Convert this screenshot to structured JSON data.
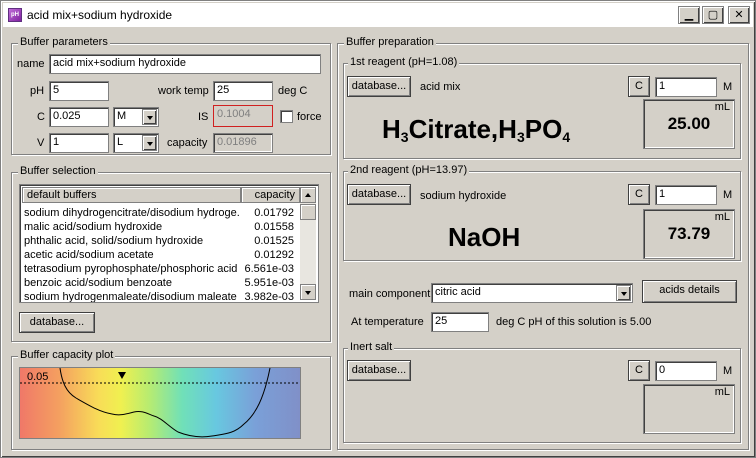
{
  "window": {
    "title": "acid mix+sodium hydroxide",
    "icon_text": "pH"
  },
  "buffer_parameters": {
    "legend": "Buffer parameters",
    "name_label": "name",
    "name_value": "acid mix+sodium hydroxide",
    "ph_label": "pH",
    "ph_value": "5",
    "work_temp_label": "work temp",
    "work_temp_value": "25",
    "work_temp_unit": "deg C",
    "c_label": "C",
    "c_value": "0.025",
    "c_unit": "M",
    "is_label": "IS",
    "is_value": "0.1004",
    "force_label": "force",
    "v_label": "V",
    "v_value": "1",
    "v_unit": "L",
    "capacity_label": "capacity",
    "capacity_value": "0.01896"
  },
  "buffer_selection": {
    "legend": "Buffer selection",
    "columns": [
      "default buffers",
      "capacity"
    ],
    "rows": [
      {
        "name": "sodium dihydrogencitrate/disodium hydroge...",
        "capacity": "0.01792"
      },
      {
        "name": "malic acid/sodium hydroxide",
        "capacity": "0.01558"
      },
      {
        "name": "phthalic acid, solid/sodium hydroxide",
        "capacity": "0.01525"
      },
      {
        "name": "acetic acid/sodium acetate",
        "capacity": "0.01292"
      },
      {
        "name": "tetrasodium pyrophosphate/phosphoric acid",
        "capacity": "6.561e-03"
      },
      {
        "name": "benzoic acid/sodium benzoate",
        "capacity": "5.951e-03"
      },
      {
        "name": "sodium hydrogenmaleate/disodium maleate",
        "capacity": "3.982e-03"
      }
    ],
    "database_button": "database..."
  },
  "capacity_plot": {
    "legend": "Buffer capacity plot",
    "level_label": "0.05"
  },
  "buffer_preparation": {
    "legend": "Buffer preparation",
    "reagent1": {
      "legend": "1st reagent (pH=1.08)",
      "database_button": "database...",
      "name": "acid mix",
      "c_button": "C",
      "c_value": "1",
      "c_unit": "M",
      "formula_parts": [
        "H",
        "3",
        "Citrate,H",
        "3",
        "PO",
        "4"
      ],
      "volume_unit": "mL",
      "volume": "25.00"
    },
    "reagent2": {
      "legend": "2nd reagent (pH=13.97)",
      "database_button": "database...",
      "name": "sodium hydroxide",
      "c_button": "C",
      "c_value": "1",
      "c_unit": "M",
      "formula": "NaOH",
      "volume_unit": "mL",
      "volume": "73.79"
    },
    "main_component_label": "main component",
    "main_component_value": "citric acid",
    "acids_details_button": "acids details",
    "at_temperature_label": "At temperature",
    "at_temperature_value": "25",
    "temperature_note": "deg C pH of this solution is 5.00",
    "inert_salt": {
      "legend": "Inert salt",
      "database_button": "database...",
      "c_button": "C",
      "c_value": "0",
      "c_unit": "M",
      "volume_unit": "mL"
    }
  }
}
